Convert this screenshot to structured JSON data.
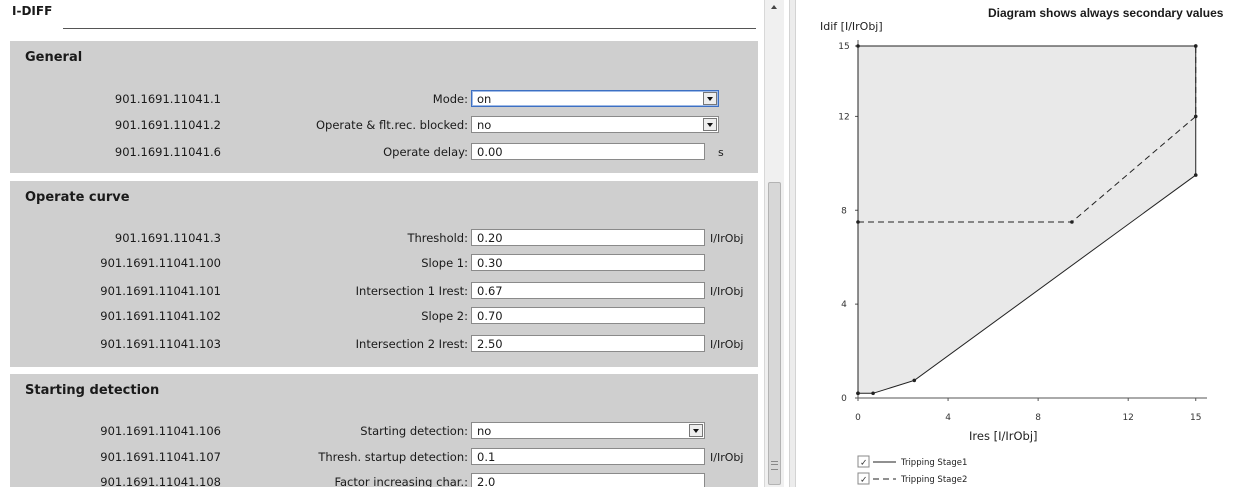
{
  "panel": {
    "title": "I-DIFF",
    "sections": [
      {
        "title": "General",
        "rows": [
          {
            "id": "901.1691.11041.1",
            "label": "Mode:",
            "value": "on",
            "type": "dropdown",
            "unit": ""
          },
          {
            "id": "901.1691.11041.2",
            "label": "Operate & flt.rec. blocked:",
            "value": "no",
            "type": "dropdown",
            "unit": ""
          },
          {
            "id": "901.1691.11041.6",
            "label": "Operate delay:",
            "value": "0.00",
            "type": "text",
            "unit": "s"
          }
        ]
      },
      {
        "title": "Operate curve",
        "rows": [
          {
            "id": "901.1691.11041.3",
            "label": "Threshold:",
            "value": "0.20",
            "type": "text",
            "unit": "I/IrObj"
          },
          {
            "id": "901.1691.11041.100",
            "label": "Slope 1:",
            "value": "0.30",
            "type": "text",
            "unit": ""
          },
          {
            "id": "901.1691.11041.101",
            "label": "Intersection 1 Irest:",
            "value": "0.67",
            "type": "text",
            "unit": "I/IrObj"
          },
          {
            "id": "901.1691.11041.102",
            "label": "Slope 2:",
            "value": "0.70",
            "type": "text",
            "unit": ""
          },
          {
            "id": "901.1691.11041.103",
            "label": "Intersection 2 Irest:",
            "value": "2.50",
            "type": "text",
            "unit": "I/IrObj"
          }
        ]
      },
      {
        "title": "Starting detection",
        "rows": [
          {
            "id": "901.1691.11041.106",
            "label": "Starting detection:",
            "value": "no",
            "type": "dropdown",
            "unit": ""
          },
          {
            "id": "901.1691.11041.107",
            "label": "Thresh. startup detection:",
            "value": "0.1",
            "type": "text",
            "unit": "I/IrObj"
          },
          {
            "id": "901.1691.11041.108",
            "label": "Factor increasing char.:",
            "value": "2.0",
            "type": "text",
            "unit": ""
          }
        ]
      }
    ]
  },
  "diagram": {
    "title": "Diagram shows always secondary values"
  },
  "chart_data": {
    "type": "line",
    "title": "Diagram shows always secondary values",
    "xlabel": "Ires [I/IrObj]",
    "ylabel": "Idif [I/IrObj]",
    "xlim": [
      0,
      15.5
    ],
    "ylim": [
      0,
      15
    ],
    "xticks": [
      "0",
      "4",
      "8",
      "12",
      "15"
    ],
    "yticks": [
      "0",
      "4",
      "8",
      "12",
      "15"
    ],
    "series": [
      {
        "name": "Tripping Stage1",
        "style": "solid",
        "color": "#222222",
        "points": [
          [
            0,
            0.2
          ],
          [
            0.67,
            0.2
          ],
          [
            2.5,
            0.75
          ],
          [
            15,
            9.5
          ],
          [
            15,
            15
          ],
          [
            0,
            15
          ],
          [
            0,
            0.2
          ]
        ]
      },
      {
        "name": "Tripping Stage2",
        "style": "dashed",
        "color": "#222222",
        "points": [
          [
            0,
            7.5
          ],
          [
            9.5,
            7.5
          ],
          [
            15,
            12
          ],
          [
            15,
            15
          ]
        ]
      }
    ],
    "fill_color": "#e9e9e9",
    "legend_position": "bottom-left",
    "legend_checked": [
      true,
      true
    ]
  }
}
